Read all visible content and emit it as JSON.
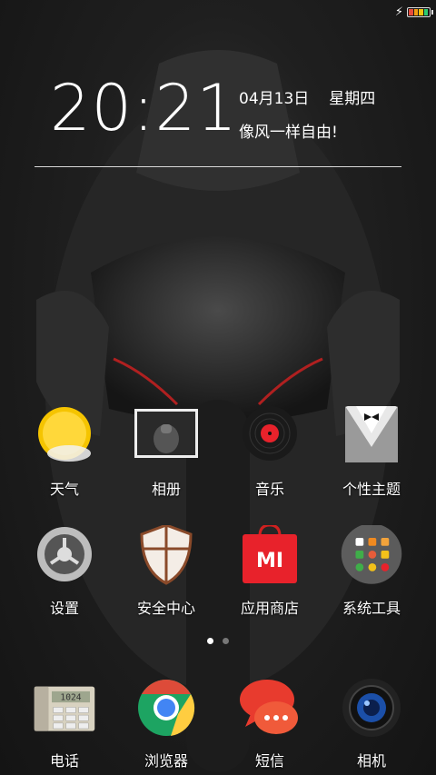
{
  "status": {
    "charging_icon": "bolt-icon",
    "battery_icon": "battery-icon"
  },
  "clock": {
    "time": "20:21",
    "date": "04月13日",
    "weekday": "星期四",
    "motto": "像风一样自由!"
  },
  "apps": {
    "row1": [
      {
        "label": "天气",
        "icon": "weather-sun-icon"
      },
      {
        "label": "相册",
        "icon": "gallery-icon"
      },
      {
        "label": "音乐",
        "icon": "music-record-icon"
      },
      {
        "label": "个性主题",
        "icon": "themes-tuxedo-icon"
      }
    ],
    "row2": [
      {
        "label": "设置",
        "icon": "settings-gear-icon"
      },
      {
        "label": "安全中心",
        "icon": "security-shield-icon"
      },
      {
        "label": "应用商店",
        "icon": "mi-store-bag-icon"
      },
      {
        "label": "系统工具",
        "icon": "system-tools-folder-icon"
      }
    ],
    "dock": [
      {
        "label": "电话",
        "icon": "phone-icon",
        "display": "1024"
      },
      {
        "label": "浏览器",
        "icon": "browser-chrome-icon"
      },
      {
        "label": "短信",
        "icon": "messages-bubble-icon"
      },
      {
        "label": "相机",
        "icon": "camera-lens-icon"
      }
    ]
  },
  "pager": {
    "pages": 2,
    "current": 1
  },
  "colors": {
    "accent_red": "#e8222b",
    "sun_yellow": "#f5c400"
  }
}
